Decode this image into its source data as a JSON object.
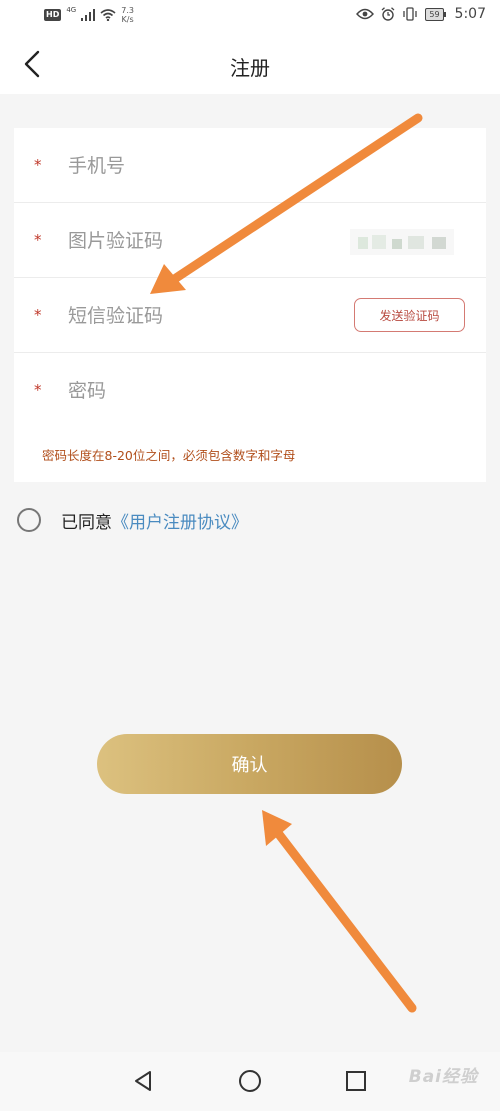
{
  "status_bar": {
    "hd": "HD",
    "network_type": "4G",
    "speed_value": "7.3",
    "speed_unit": "K/s",
    "battery": "59",
    "time": "5:07"
  },
  "header": {
    "title": "注册",
    "back_icon": "chevron-left-icon"
  },
  "form": {
    "required_mark": "*",
    "phone_placeholder": "手机号",
    "captcha_placeholder": "图片验证码",
    "sms_placeholder": "短信验证码",
    "sms_button_label": "发送验证码",
    "password_placeholder": "密码",
    "password_hint": "密码长度在8-20位之间，必须包含数字和字母"
  },
  "agreement": {
    "prefix": "已同意",
    "link": "《用户注册协议》"
  },
  "confirm_label": "确认",
  "system_nav": {
    "back_icon": "triangle-back-icon",
    "home_icon": "circle-home-icon",
    "recents_icon": "square-recents-icon"
  },
  "watermark": "Bai经验",
  "colors": {
    "required_star": "#c0392b",
    "hint_text": "#b14f1c",
    "link": "#4a8bc0",
    "confirm_gradient_start": "#dcc17f",
    "confirm_gradient_end": "#b68f4b",
    "annotation_arrow": "#f08a3c"
  }
}
